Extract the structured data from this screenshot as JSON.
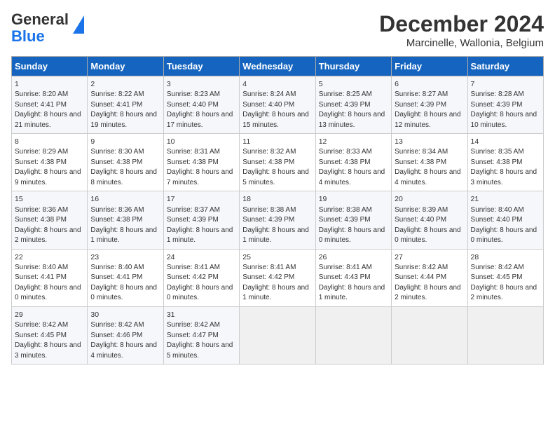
{
  "header": {
    "logo_general": "General",
    "logo_blue": "Blue",
    "month": "December 2024",
    "location": "Marcinelle, Wallonia, Belgium"
  },
  "days_of_week": [
    "Sunday",
    "Monday",
    "Tuesday",
    "Wednesday",
    "Thursday",
    "Friday",
    "Saturday"
  ],
  "weeks": [
    [
      {
        "day": "1",
        "sunrise": "Sunrise: 8:20 AM",
        "sunset": "Sunset: 4:41 PM",
        "daylight": "Daylight: 8 hours and 21 minutes."
      },
      {
        "day": "2",
        "sunrise": "Sunrise: 8:22 AM",
        "sunset": "Sunset: 4:41 PM",
        "daylight": "Daylight: 8 hours and 19 minutes."
      },
      {
        "day": "3",
        "sunrise": "Sunrise: 8:23 AM",
        "sunset": "Sunset: 4:40 PM",
        "daylight": "Daylight: 8 hours and 17 minutes."
      },
      {
        "day": "4",
        "sunrise": "Sunrise: 8:24 AM",
        "sunset": "Sunset: 4:40 PM",
        "daylight": "Daylight: 8 hours and 15 minutes."
      },
      {
        "day": "5",
        "sunrise": "Sunrise: 8:25 AM",
        "sunset": "Sunset: 4:39 PM",
        "daylight": "Daylight: 8 hours and 13 minutes."
      },
      {
        "day": "6",
        "sunrise": "Sunrise: 8:27 AM",
        "sunset": "Sunset: 4:39 PM",
        "daylight": "Daylight: 8 hours and 12 minutes."
      },
      {
        "day": "7",
        "sunrise": "Sunrise: 8:28 AM",
        "sunset": "Sunset: 4:39 PM",
        "daylight": "Daylight: 8 hours and 10 minutes."
      }
    ],
    [
      {
        "day": "8",
        "sunrise": "Sunrise: 8:29 AM",
        "sunset": "Sunset: 4:38 PM",
        "daylight": "Daylight: 8 hours and 9 minutes."
      },
      {
        "day": "9",
        "sunrise": "Sunrise: 8:30 AM",
        "sunset": "Sunset: 4:38 PM",
        "daylight": "Daylight: 8 hours and 8 minutes."
      },
      {
        "day": "10",
        "sunrise": "Sunrise: 8:31 AM",
        "sunset": "Sunset: 4:38 PM",
        "daylight": "Daylight: 8 hours and 7 minutes."
      },
      {
        "day": "11",
        "sunrise": "Sunrise: 8:32 AM",
        "sunset": "Sunset: 4:38 PM",
        "daylight": "Daylight: 8 hours and 5 minutes."
      },
      {
        "day": "12",
        "sunrise": "Sunrise: 8:33 AM",
        "sunset": "Sunset: 4:38 PM",
        "daylight": "Daylight: 8 hours and 4 minutes."
      },
      {
        "day": "13",
        "sunrise": "Sunrise: 8:34 AM",
        "sunset": "Sunset: 4:38 PM",
        "daylight": "Daylight: 8 hours and 4 minutes."
      },
      {
        "day": "14",
        "sunrise": "Sunrise: 8:35 AM",
        "sunset": "Sunset: 4:38 PM",
        "daylight": "Daylight: 8 hours and 3 minutes."
      }
    ],
    [
      {
        "day": "15",
        "sunrise": "Sunrise: 8:36 AM",
        "sunset": "Sunset: 4:38 PM",
        "daylight": "Daylight: 8 hours and 2 minutes."
      },
      {
        "day": "16",
        "sunrise": "Sunrise: 8:36 AM",
        "sunset": "Sunset: 4:38 PM",
        "daylight": "Daylight: 8 hours and 1 minute."
      },
      {
        "day": "17",
        "sunrise": "Sunrise: 8:37 AM",
        "sunset": "Sunset: 4:39 PM",
        "daylight": "Daylight: 8 hours and 1 minute."
      },
      {
        "day": "18",
        "sunrise": "Sunrise: 8:38 AM",
        "sunset": "Sunset: 4:39 PM",
        "daylight": "Daylight: 8 hours and 1 minute."
      },
      {
        "day": "19",
        "sunrise": "Sunrise: 8:38 AM",
        "sunset": "Sunset: 4:39 PM",
        "daylight": "Daylight: 8 hours and 0 minutes."
      },
      {
        "day": "20",
        "sunrise": "Sunrise: 8:39 AM",
        "sunset": "Sunset: 4:40 PM",
        "daylight": "Daylight: 8 hours and 0 minutes."
      },
      {
        "day": "21",
        "sunrise": "Sunrise: 8:40 AM",
        "sunset": "Sunset: 4:40 PM",
        "daylight": "Daylight: 8 hours and 0 minutes."
      }
    ],
    [
      {
        "day": "22",
        "sunrise": "Sunrise: 8:40 AM",
        "sunset": "Sunset: 4:41 PM",
        "daylight": "Daylight: 8 hours and 0 minutes."
      },
      {
        "day": "23",
        "sunrise": "Sunrise: 8:40 AM",
        "sunset": "Sunset: 4:41 PM",
        "daylight": "Daylight: 8 hours and 0 minutes."
      },
      {
        "day": "24",
        "sunrise": "Sunrise: 8:41 AM",
        "sunset": "Sunset: 4:42 PM",
        "daylight": "Daylight: 8 hours and 0 minutes."
      },
      {
        "day": "25",
        "sunrise": "Sunrise: 8:41 AM",
        "sunset": "Sunset: 4:42 PM",
        "daylight": "Daylight: 8 hours and 1 minute."
      },
      {
        "day": "26",
        "sunrise": "Sunrise: 8:41 AM",
        "sunset": "Sunset: 4:43 PM",
        "daylight": "Daylight: 8 hours and 1 minute."
      },
      {
        "day": "27",
        "sunrise": "Sunrise: 8:42 AM",
        "sunset": "Sunset: 4:44 PM",
        "daylight": "Daylight: 8 hours and 2 minutes."
      },
      {
        "day": "28",
        "sunrise": "Sunrise: 8:42 AM",
        "sunset": "Sunset: 4:45 PM",
        "daylight": "Daylight: 8 hours and 2 minutes."
      }
    ],
    [
      {
        "day": "29",
        "sunrise": "Sunrise: 8:42 AM",
        "sunset": "Sunset: 4:45 PM",
        "daylight": "Daylight: 8 hours and 3 minutes."
      },
      {
        "day": "30",
        "sunrise": "Sunrise: 8:42 AM",
        "sunset": "Sunset: 4:46 PM",
        "daylight": "Daylight: 8 hours and 4 minutes."
      },
      {
        "day": "31",
        "sunrise": "Sunrise: 8:42 AM",
        "sunset": "Sunset: 4:47 PM",
        "daylight": "Daylight: 8 hours and 5 minutes."
      },
      null,
      null,
      null,
      null
    ]
  ]
}
